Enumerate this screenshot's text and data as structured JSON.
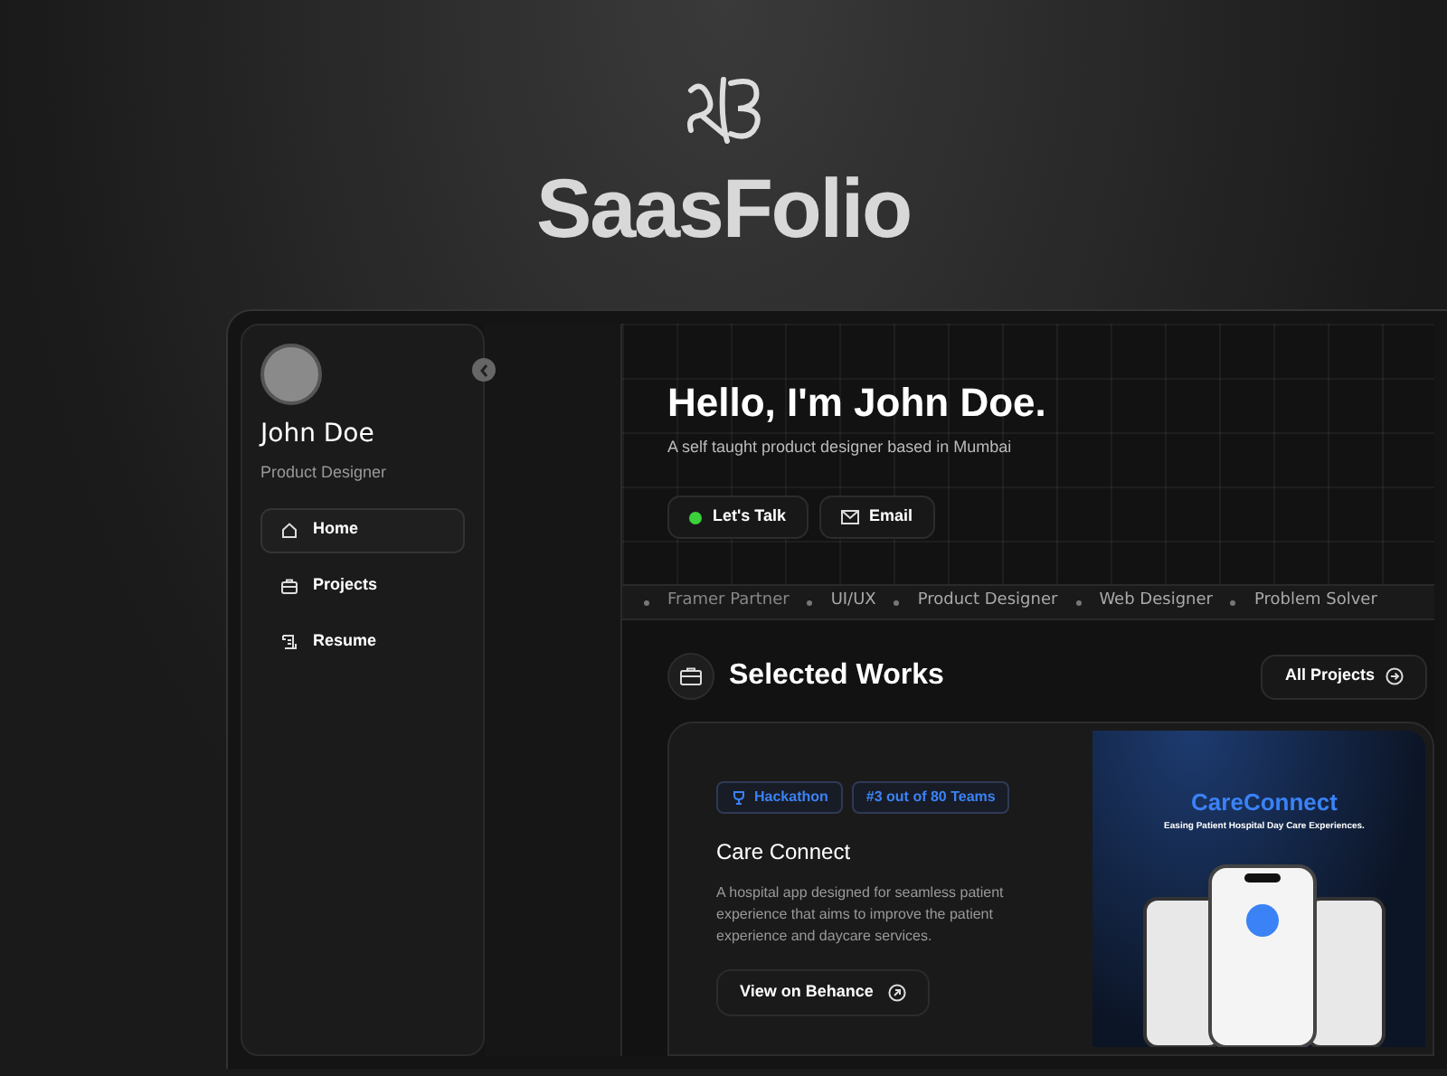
{
  "brand": {
    "title": "SaasFolio"
  },
  "profile": {
    "name": "John Doe",
    "role": "Product Designer"
  },
  "nav": [
    {
      "label": "Home",
      "kind": "home",
      "selected": true
    },
    {
      "label": "Projects",
      "kind": "briefcase",
      "selected": false
    },
    {
      "label": "Resume",
      "kind": "scroll",
      "selected": false
    }
  ],
  "hero": {
    "heading": "Hello, I'm John Doe.",
    "tagline": "A self taught product designer based in Mumbai",
    "buttons": [
      {
        "label": "Let's Talk",
        "kind": "status"
      },
      {
        "label": "Email",
        "kind": "mail"
      }
    ]
  },
  "skills": [
    "Framer Partner",
    "UI/UX",
    "Product Designer",
    "Web Designer",
    "Problem Solver"
  ],
  "works": {
    "title": "Selected Works",
    "all_button": "All Projects",
    "project": {
      "tags": [
        {
          "label": "Hackathon",
          "kind": "trophy"
        },
        {
          "label": "#3 out of 80 Teams",
          "kind": "plain"
        }
      ],
      "title": "Care Connect",
      "description": "A hospital app designed for seamless patient experience that aims to improve the patient experience and daycare services.",
      "link": "View on Behance",
      "image": {
        "title": "CareConnect",
        "subtitle": "Easing Patient Hospital Day Care Experiences."
      }
    }
  }
}
